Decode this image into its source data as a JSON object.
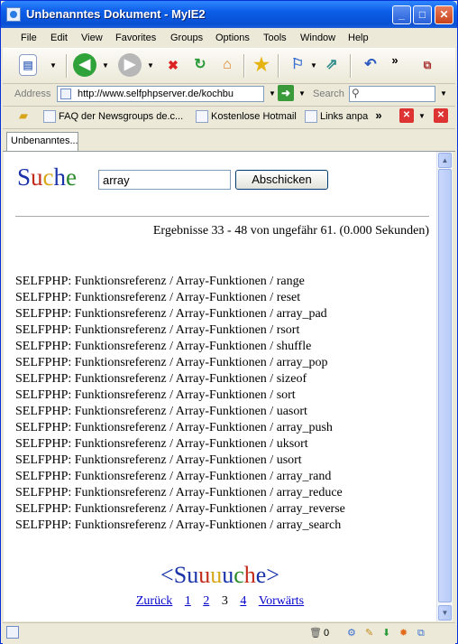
{
  "window": {
    "title": "Unbenanntes Dokument - MyIE2",
    "min": "_",
    "max": "□",
    "close": "✕"
  },
  "menu": [
    "File",
    "Edit",
    "View",
    "Favorites",
    "Groups",
    "Options",
    "Tools",
    "Window",
    "Help"
  ],
  "address": {
    "label": "Address",
    "url": "http://www.selfphpserver.de/kochbu",
    "go_icon": "go-arrow-icon"
  },
  "search": {
    "label": "Search"
  },
  "links": [
    "FAQ der Newsgroups de.c...",
    "Kostenlose Hotmail",
    "Links anpa"
  ],
  "tab": {
    "label": "Unbenanntes..."
  },
  "page": {
    "logo": {
      "letters": [
        "S",
        "u",
        "c",
        "h",
        "e"
      ],
      "colors": [
        "#1a33a8",
        "#c22a1a",
        "#d8a71a",
        "#1a33a8",
        "#2a8a2a"
      ]
    },
    "query": "array",
    "submit_label": "Abschicken",
    "stats": "Ergebnisse 33 - 48 von ungefähr 61. (0.000 Sekunden)",
    "results": [
      "SELFPHP: Funktionsreferenz / Array-Funktionen / range",
      "SELFPHP: Funktionsreferenz / Array-Funktionen / reset",
      "SELFPHP: Funktionsreferenz / Array-Funktionen / array_pad",
      "SELFPHP: Funktionsreferenz / Array-Funktionen / rsort",
      "SELFPHP: Funktionsreferenz / Array-Funktionen / shuffle",
      "SELFPHP: Funktionsreferenz / Array-Funktionen / array_pop",
      "SELFPHP: Funktionsreferenz / Array-Funktionen / sizeof",
      "SELFPHP: Funktionsreferenz / Array-Funktionen / sort",
      "SELFPHP: Funktionsreferenz / Array-Funktionen / uasort",
      "SELFPHP: Funktionsreferenz / Array-Funktionen / array_push",
      "SELFPHP: Funktionsreferenz / Array-Funktionen / uksort",
      "SELFPHP: Funktionsreferenz / Array-Funktionen / usort",
      "SELFPHP: Funktionsreferenz / Array-Funktionen / array_rand",
      "SELFPHP: Funktionsreferenz / Array-Funktionen / array_reduce",
      "SELFPHP: Funktionsreferenz / Array-Funktionen / array_reverse",
      "SELFPHP: Funktionsreferenz / Array-Funktionen / array_search"
    ],
    "pager_logo": {
      "left": "<",
      "letters": [
        "S",
        "u",
        "u",
        "u",
        "u",
        "c",
        "h",
        "e"
      ],
      "colors": [
        "#1a33a8",
        "#1a33a8",
        "#c22a1a",
        "#d8a71a",
        "#1a33a8",
        "#2a8a2a",
        "#c22a1a",
        "#1a33a8"
      ],
      "right": ">"
    },
    "pager": {
      "prev": "Zurück",
      "pages": [
        "1",
        "2",
        "3",
        "4"
      ],
      "current": "3",
      "next": "Vorwärts"
    }
  },
  "status": {
    "popup_count": "0"
  }
}
